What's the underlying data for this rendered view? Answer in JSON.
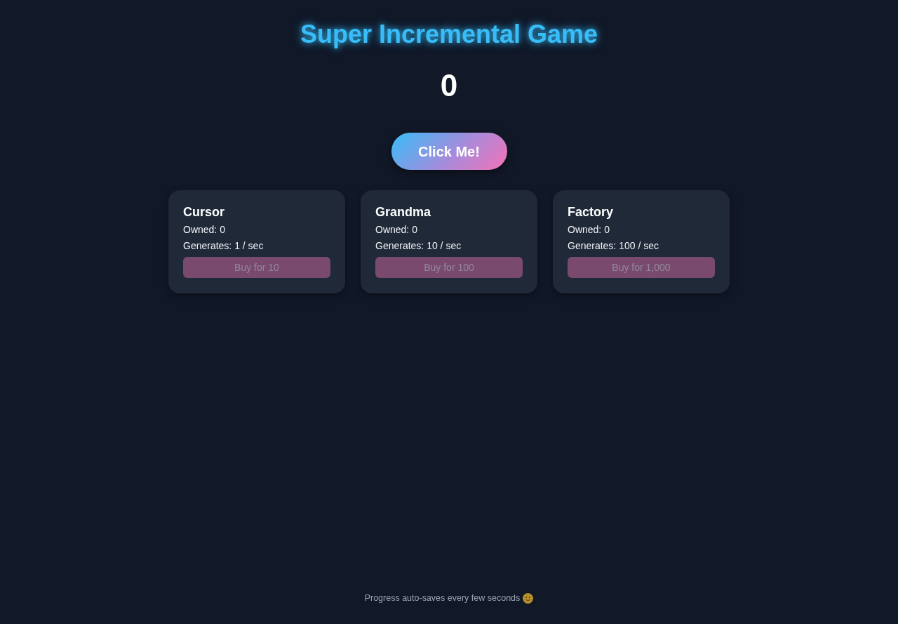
{
  "title": "Super Incremental Game",
  "score": "0",
  "click_button": {
    "label": "Click Me!"
  },
  "buildings": [
    {
      "name": "Cursor",
      "owned": "Owned: 0",
      "generates": "Generates: 1 / sec",
      "buy_button": {
        "label": "Buy for 10",
        "disabled": true
      }
    },
    {
      "name": "Grandma",
      "owned": "Owned: 0",
      "generates": "Generates: 10 / sec",
      "buy_button": {
        "label": "Buy for 100",
        "disabled": true
      }
    },
    {
      "name": "Factory",
      "owned": "Owned: 0",
      "generates": "Generates: 100 / sec",
      "buy_button": {
        "label": "Buy for 1,000",
        "disabled": true
      }
    }
  ],
  "footer": {
    "text": "Progress auto-saves every few seconds"
  }
}
